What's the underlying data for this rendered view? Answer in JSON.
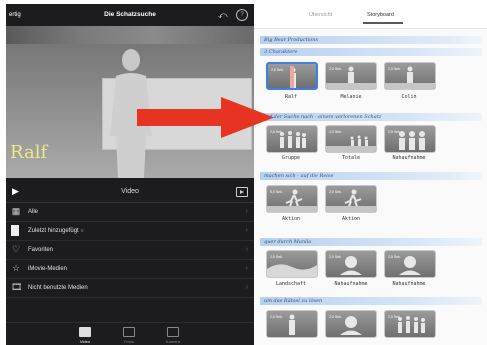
{
  "left_panel": {
    "done_label": "ertig",
    "title": "Die Schatzsuche",
    "undo_icon": "undo-icon",
    "help_label": "?",
    "preview_caption": "Ralf",
    "video_label": "Video",
    "media_rows": [
      {
        "icon": "grid-icon",
        "label": "Alle",
        "badge": ""
      },
      {
        "icon": "recent-icon",
        "label": "Zuletzt hinzugefügt",
        "badge": "≡"
      },
      {
        "icon": "heart-icon",
        "label": "Favoriten",
        "badge": ""
      },
      {
        "icon": "star-icon",
        "label": "iMovie-Medien",
        "badge": ""
      },
      {
        "icon": "film-icon",
        "label": "Nicht benutzte Medien",
        "badge": ""
      }
    ],
    "tabs": [
      {
        "label": "Video",
        "active": true
      },
      {
        "label": "Fotos",
        "active": false
      },
      {
        "label": "Kamera",
        "active": false
      }
    ]
  },
  "right_panel": {
    "segment_overview": "Übersicht",
    "segment_storyboard": "Storyboard",
    "sections": [
      {
        "header": "Big Bear Productions"
      },
      {
        "header": "3 Charaktere",
        "clips": [
          {
            "dur": "2,5 Sek.",
            "caption": "Ralf",
            "selected": true
          },
          {
            "dur": "2,5 Sek.",
            "caption": "Melanie",
            "selected": false
          },
          {
            "dur": "2,5 Sek.",
            "caption": "Colin",
            "selected": false
          }
        ]
      },
      {
        "header": "auf der Suche nach - einem verlorenen Schatz",
        "clips": [
          {
            "dur": "2,5 Sek.",
            "caption": "Gruppe",
            "selected": false
          },
          {
            "dur": "4,0 Sek.",
            "caption": "Totale",
            "selected": false
          },
          {
            "dur": "2,5 Sek.",
            "caption": "Nahaufnahme",
            "selected": false
          }
        ]
      },
      {
        "header": "machen sich - auf die Reise",
        "clips": [
          {
            "dur": "5,0 Sek.",
            "caption": "Aktion",
            "selected": false
          },
          {
            "dur": "2,5 Sek.",
            "caption": "Aktion",
            "selected": false
          }
        ]
      },
      {
        "header": "quer durch Manila",
        "clips": [
          {
            "dur": "2,5 Sek.",
            "caption": "Landschaft",
            "selected": false
          },
          {
            "dur": "2,5 Sek.",
            "caption": "Nahaufnahme",
            "selected": false
          },
          {
            "dur": "2,5 Sek.",
            "caption": "Nahaufnahme",
            "selected": false
          }
        ]
      },
      {
        "header": "um das Rätsel zu lösen",
        "clips": [
          {
            "dur": "2,5 Sek.",
            "caption": "",
            "selected": false
          },
          {
            "dur": "2,5 Sek.",
            "caption": "",
            "selected": false
          },
          {
            "dur": "2,5 Sek.",
            "caption": "",
            "selected": false
          }
        ]
      }
    ]
  },
  "colors": {
    "accent": "#3f7ee8",
    "arrow": "#e63322",
    "caption_yellow": "#f1e88a"
  }
}
